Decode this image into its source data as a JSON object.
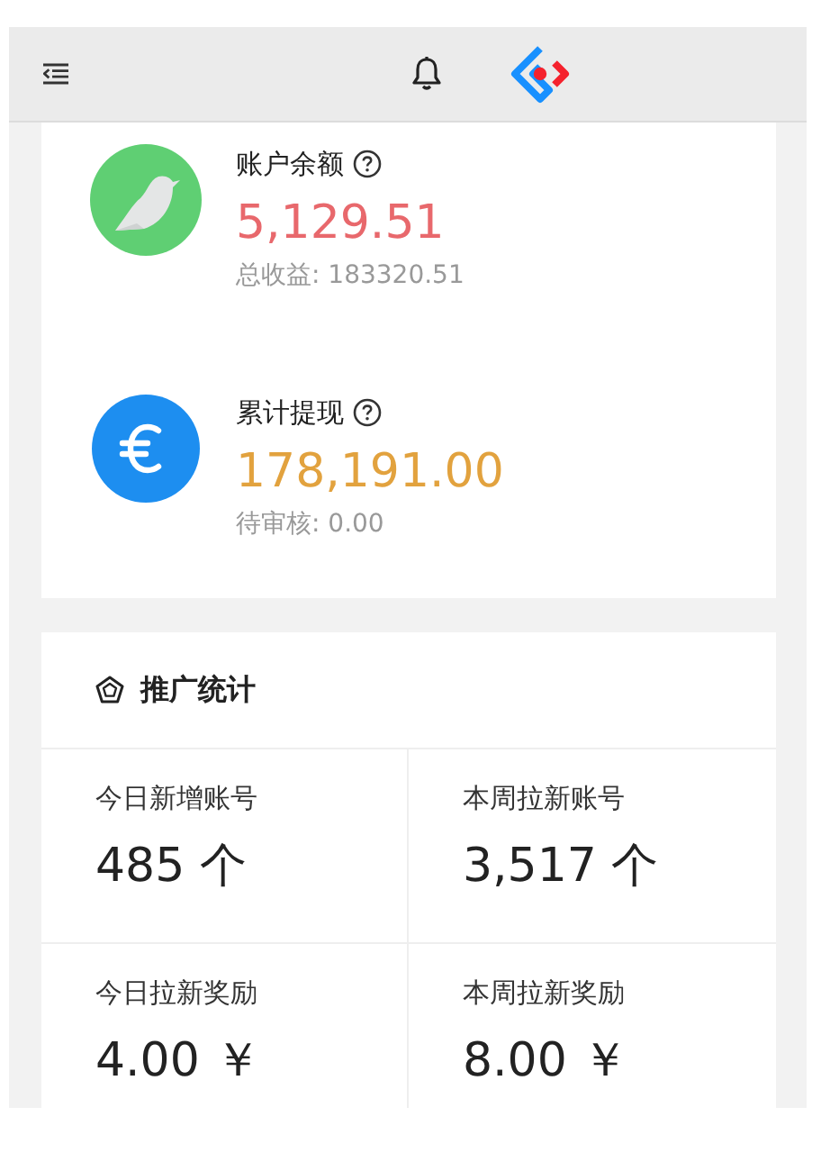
{
  "accounts": [
    {
      "kind": "balance",
      "label": "账户余额",
      "amount": "5,129.51",
      "sub": "总收益: 183320.51",
      "color": "#e8686c"
    },
    {
      "kind": "withdrawn",
      "label": "累计提现",
      "amount": "178,191.00",
      "sub": "待审核: 0.00",
      "color": "#e2a23e"
    }
  ],
  "promo": {
    "title": "推广统计",
    "stats": [
      {
        "label": "今日新增账号",
        "value": "485 个"
      },
      {
        "label": "本周拉新账号",
        "value": "3,517 个"
      },
      {
        "label": "今日拉新奖励",
        "value": "4.00 ￥"
      },
      {
        "label": "本周拉新奖励",
        "value": "8.00 ￥"
      }
    ]
  }
}
